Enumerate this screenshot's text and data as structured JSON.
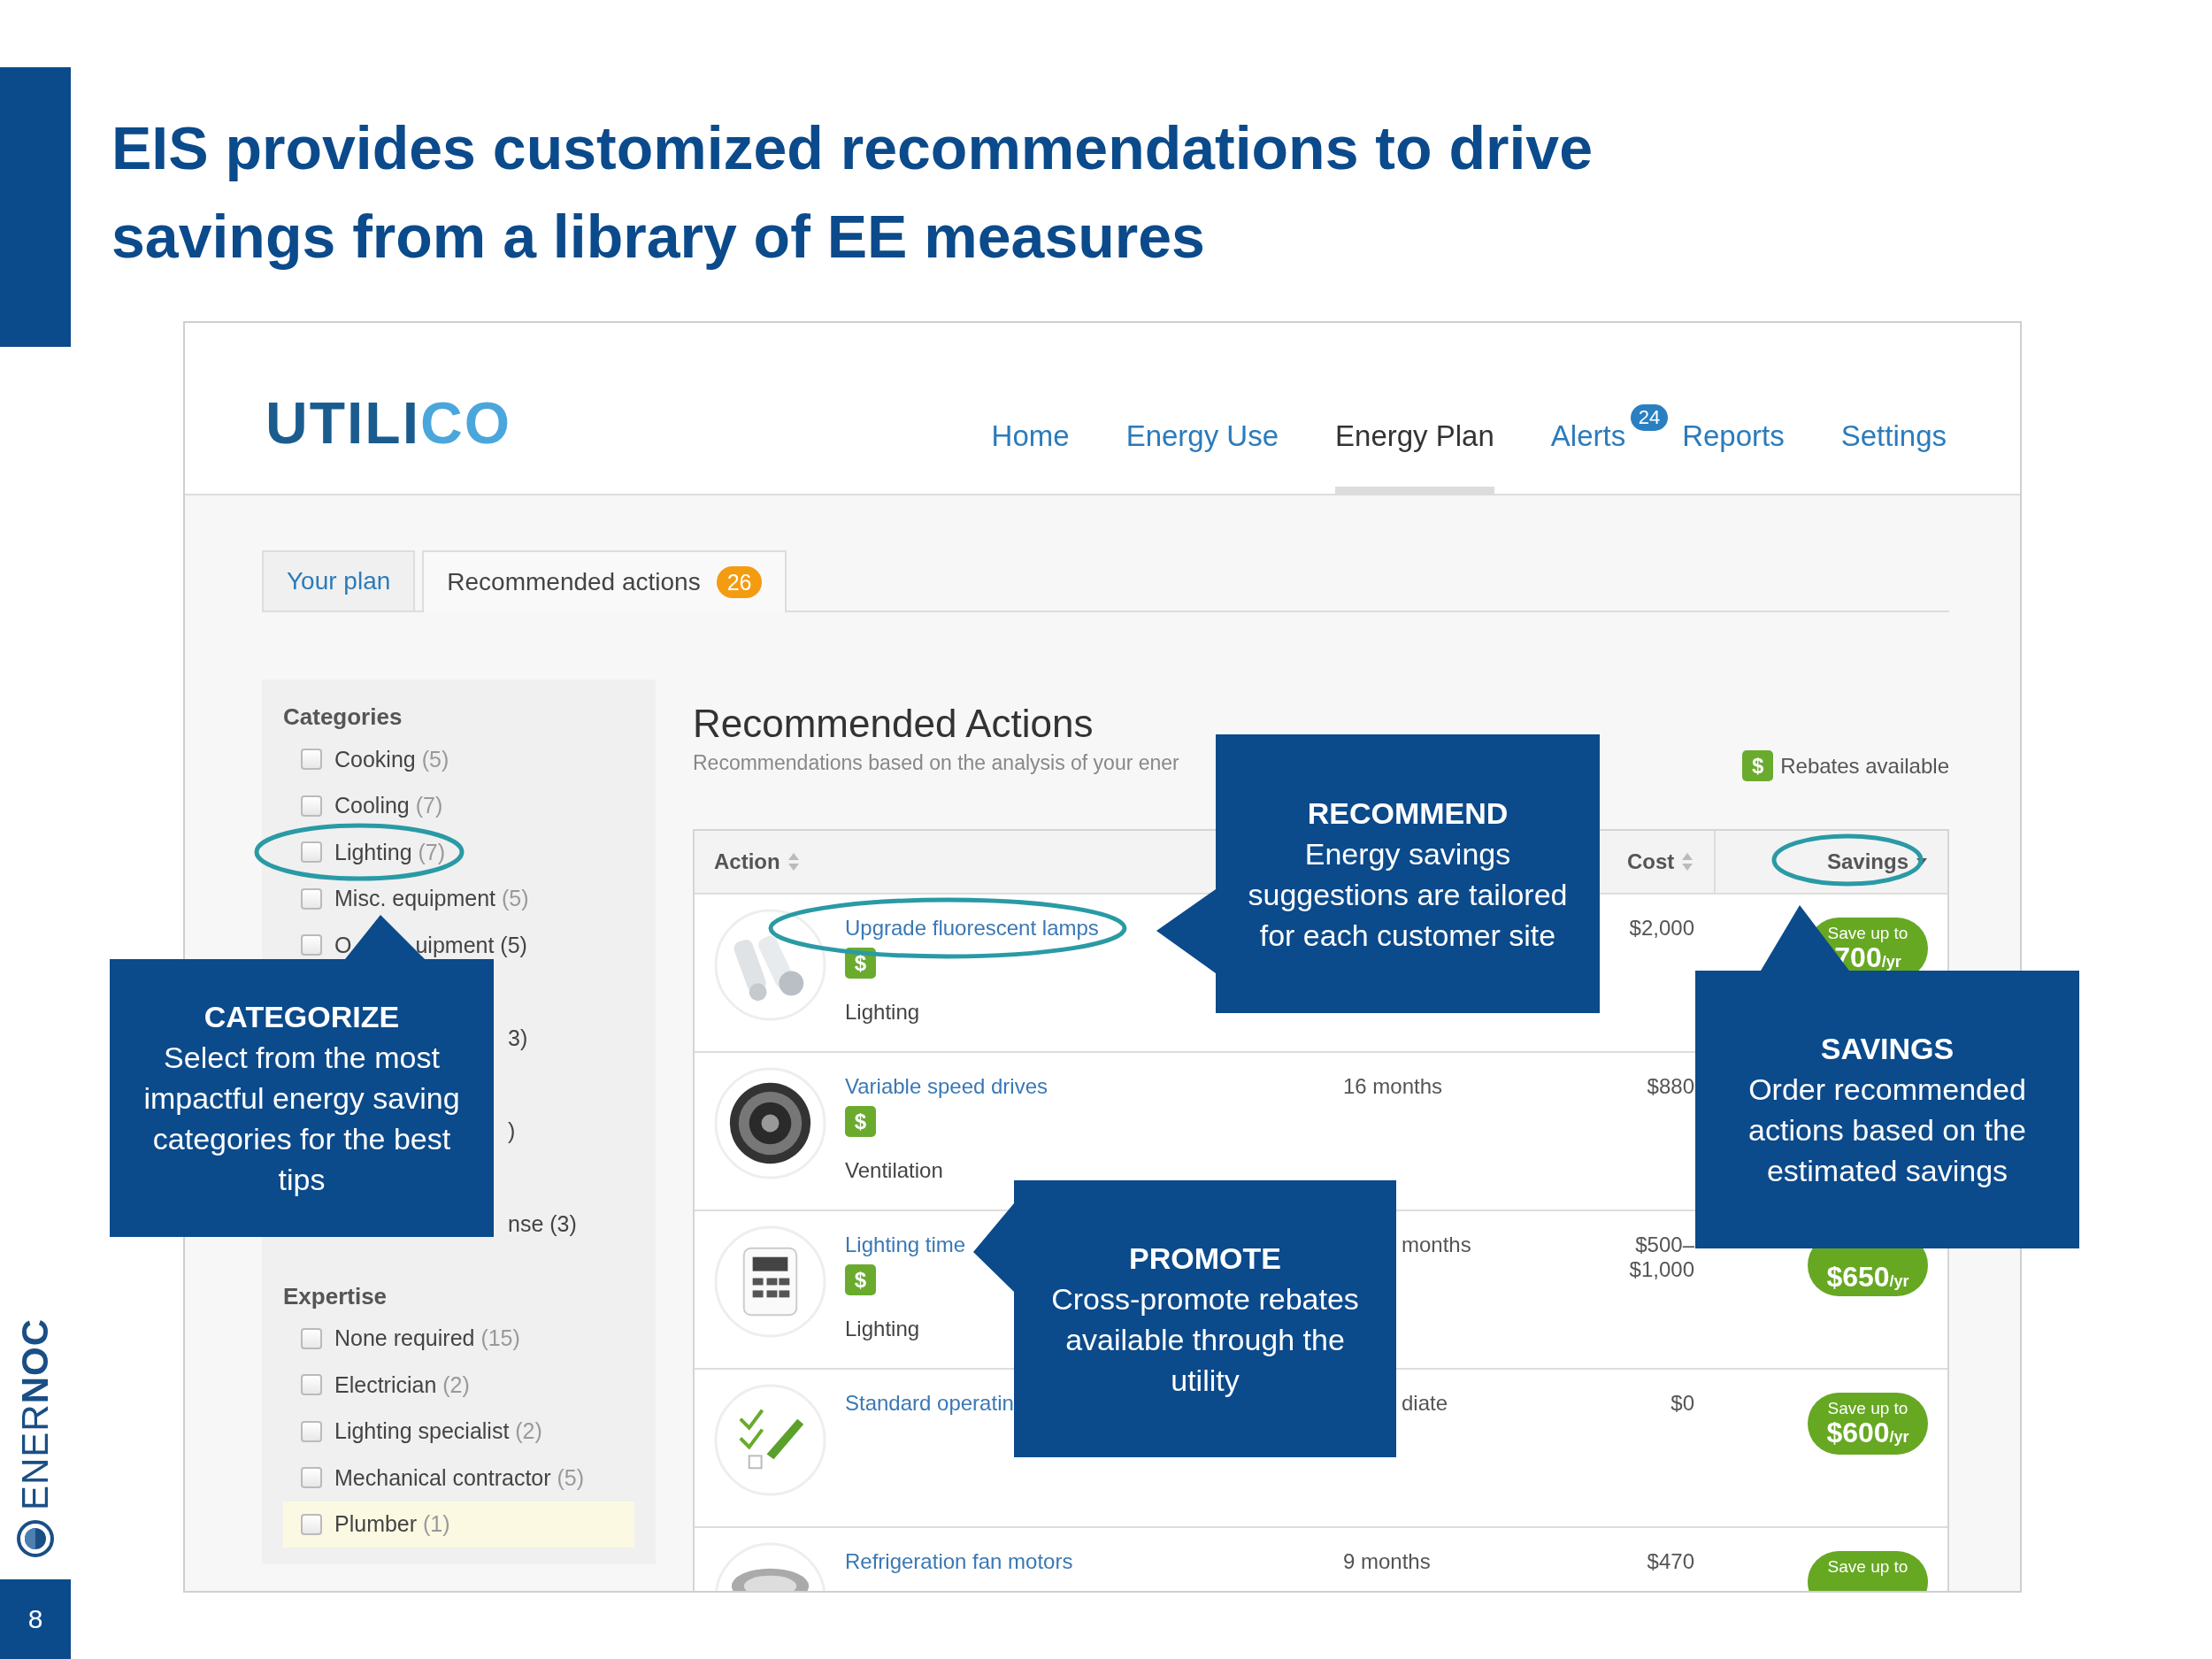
{
  "slide": {
    "title": "EIS provides customized recommendations to drive savings from a library of EE measures",
    "brand": [
      "ENER",
      "NOC"
    ],
    "page_number": "8"
  },
  "app": {
    "logo": [
      "UTILI",
      "CO"
    ],
    "nav": [
      {
        "label": "Home",
        "selected": false
      },
      {
        "label": "Energy Use",
        "selected": false
      },
      {
        "label": "Energy Plan",
        "selected": true
      },
      {
        "label": "Alerts",
        "selected": false,
        "badge": "24"
      },
      {
        "label": "Reports",
        "selected": false
      },
      {
        "label": "Settings",
        "selected": false
      }
    ],
    "tabs": [
      {
        "label": "Your plan",
        "selected": false
      },
      {
        "label": "Recommended actions",
        "selected": true,
        "badge": "26"
      }
    ],
    "sidebar": {
      "sections": [
        {
          "heading": "Categories",
          "items": [
            {
              "kind": "full",
              "label": "Cooking",
              "count": "(5)",
              "checked": false,
              "highlighted": false
            },
            {
              "kind": "full",
              "label": "Cooling",
              "count": "(7)",
              "checked": false,
              "highlighted": false
            },
            {
              "kind": "full",
              "label": "Lighting",
              "count": "(7)",
              "checked": false,
              "highlighted": false
            },
            {
              "kind": "full",
              "label": "Misc. equipment",
              "count": "(5)",
              "checked": false,
              "highlighted": false
            },
            {
              "kind": "split",
              "head": "O",
              "tail": "uipment (5)",
              "checked": false
            },
            {
              "kind": "cut",
              "text": "3)"
            },
            {
              "kind": "cut",
              "text": ")"
            },
            {
              "kind": "cut",
              "text": "nse (3)"
            }
          ]
        },
        {
          "heading": "Expertise",
          "items": [
            {
              "kind": "full",
              "label": "None required",
              "count": "(15)",
              "checked": false,
              "highlighted": false
            },
            {
              "kind": "full",
              "label": "Electrician",
              "count": "(2)",
              "checked": false,
              "highlighted": false
            },
            {
              "kind": "full",
              "label": "Lighting specialist",
              "count": "(2)",
              "checked": false,
              "highlighted": false
            },
            {
              "kind": "full",
              "label": "Mechanical contractor",
              "count": "(5)",
              "checked": false,
              "highlighted": false
            },
            {
              "kind": "full",
              "label": "Plumber",
              "count": "(1)",
              "checked": false,
              "highlighted": true
            }
          ]
        }
      ]
    },
    "main": {
      "title": "Recommended Actions",
      "subtitle": "Recommendations based on the analysis of your ener",
      "legend": {
        "badge": "$",
        "label": "Rebates available"
      },
      "columns": {
        "action": {
          "label": "Action"
        },
        "cost": {
          "label": "Cost"
        },
        "savings": {
          "label": "Savings"
        }
      },
      "rows": [
        {
          "action": "Upgrade fluorescent lamps",
          "rebate": "$",
          "category": "Lighting",
          "cost": "$2,000",
          "savings": {
            "line1": "Save up to",
            "amount": "700",
            "unit": "/yr"
          }
        },
        {
          "action": "Variable speed drives",
          "rebate": "$",
          "category": "Ventilation",
          "payback": "16 months",
          "cost": "$880"
        },
        {
          "action": "Lighting time",
          "rebate": "$",
          "category": "Lighting",
          "payback": "months",
          "cost": "$500–\n$1,000",
          "savings": {
            "amount": "$650",
            "unit": "/yr"
          }
        },
        {
          "action": "Standard operatin",
          "payback": "diate",
          "cost": "$0",
          "savings": {
            "line1": "Save up to",
            "amount": "$600",
            "unit": "/yr"
          }
        },
        {
          "action": "Refrigeration fan motors",
          "payback": "9 months",
          "cost": "$470",
          "savings": {
            "line1": "Save up to"
          }
        }
      ]
    }
  },
  "callouts": [
    {
      "title": "CATEGORIZE",
      "body": "Select from the most impactful energy saving categories for the best tips"
    },
    {
      "title": "RECOMMEND",
      "body": "Energy savings suggestions are tailored for each customer site"
    },
    {
      "title": "SAVINGS",
      "body": "Order recommended actions based on the estimated savings"
    },
    {
      "title": "PROMOTE",
      "body": "Cross-promote rebates available through the utility"
    }
  ]
}
